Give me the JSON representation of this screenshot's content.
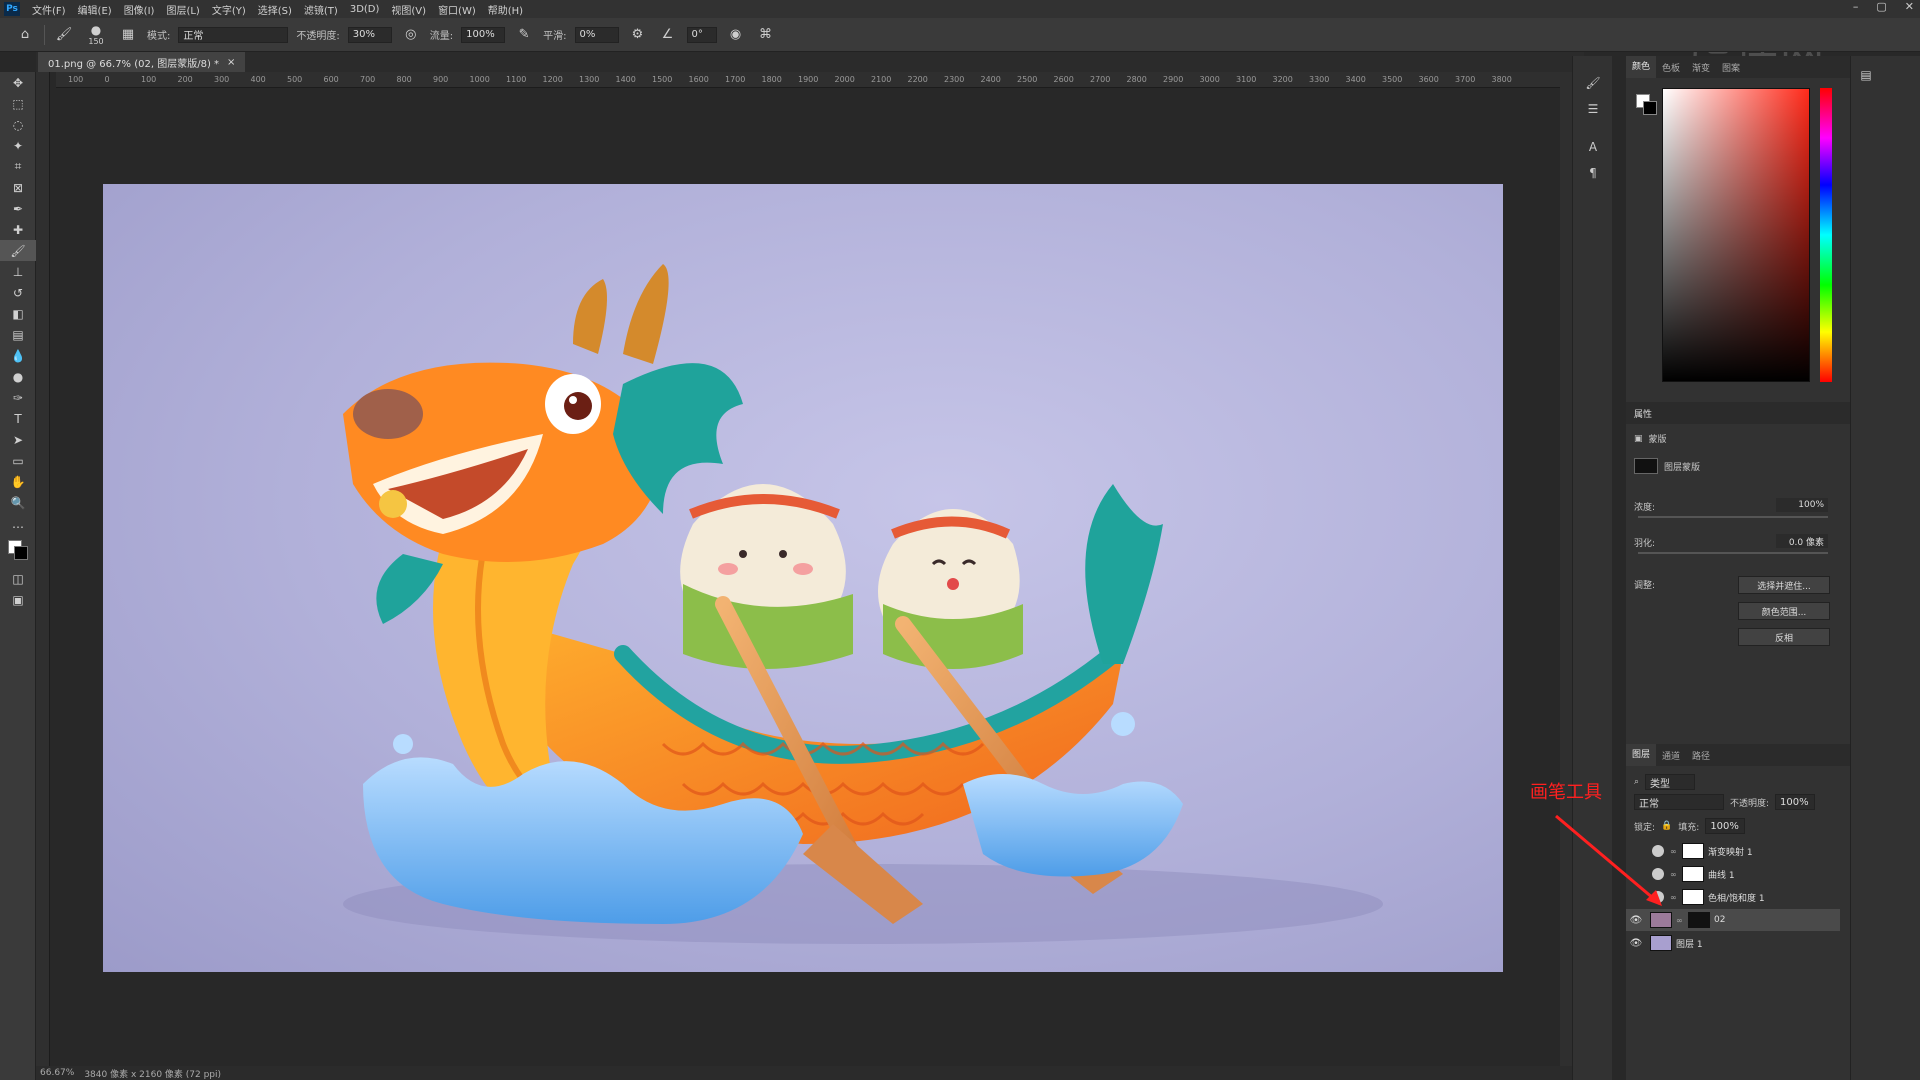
{
  "menubar": {
    "logo": "Ps",
    "items": [
      "文件(F)",
      "编辑(E)",
      "图像(I)",
      "图层(L)",
      "文字(Y)",
      "选择(S)",
      "滤镜(T)",
      "3D(D)",
      "视图(V)",
      "窗口(W)",
      "帮助(H)"
    ]
  },
  "optionsbar": {
    "brush_size": "150",
    "mode_label": "模式:",
    "mode_value": "正常",
    "opacity_label": "不透明度:",
    "opacity_value": "30%",
    "flow_label": "流量:",
    "flow_value": "100%",
    "smoothing_label": "平滑:",
    "smoothing_value": "0%",
    "angle_value": "0°"
  },
  "document": {
    "tab_title": "01.png @ 66.7% (02, 图层蒙版/8) *",
    "close": "×"
  },
  "ruler": {
    "h_ticks": [
      "100",
      "0",
      "100",
      "200",
      "300",
      "400",
      "500",
      "600",
      "700",
      "800",
      "900",
      "1000",
      "1100",
      "1200",
      "1300",
      "1400",
      "1500",
      "1600",
      "1700",
      "1800",
      "1900",
      "2000",
      "2100",
      "2200",
      "2300",
      "2400",
      "2500",
      "2600",
      "2700",
      "2800",
      "2900",
      "3000",
      "3100",
      "3200",
      "3300",
      "3400",
      "3500",
      "3600",
      "3700",
      "3800"
    ]
  },
  "status": {
    "zoom": "66.67%",
    "doc_info": "3840 像素 x 2160 像素 (72 ppi)"
  },
  "color_panel": {
    "tabs": [
      "颜色",
      "色板",
      "渐变",
      "图案"
    ]
  },
  "properties": {
    "title": "属性",
    "mask_type": "蒙版",
    "layer_mask_label": "图层蒙版",
    "density_label": "浓度:",
    "density_value": "100%",
    "feather_label": "羽化:",
    "feather_value": "0.0 像素",
    "adjust_label": "调整:",
    "btn_select_mask": "选择并遮住...",
    "btn_color_range": "颜色范围...",
    "btn_invert": "反相"
  },
  "layers_panel": {
    "tabs": [
      "图层",
      "通道",
      "路径"
    ],
    "filter_label": "类型",
    "blend_mode": "正常",
    "opacity_label": "不透明度:",
    "opacity_value": "100%",
    "lock_label": "锁定:",
    "fill_label": "填充:",
    "fill_value": "100%",
    "layers": [
      {
        "name": "渐变映射 1",
        "visible": false
      },
      {
        "name": "曲线 1",
        "visible": false
      },
      {
        "name": "色相/饱和度 1",
        "visible": false
      },
      {
        "name": "02",
        "visible": true,
        "selected": true
      },
      {
        "name": "图层 1",
        "visible": true
      }
    ]
  },
  "annotation": {
    "text": "画笔工具",
    "color": "#ff2020"
  },
  "watermark": {
    "text": "虎课网"
  }
}
